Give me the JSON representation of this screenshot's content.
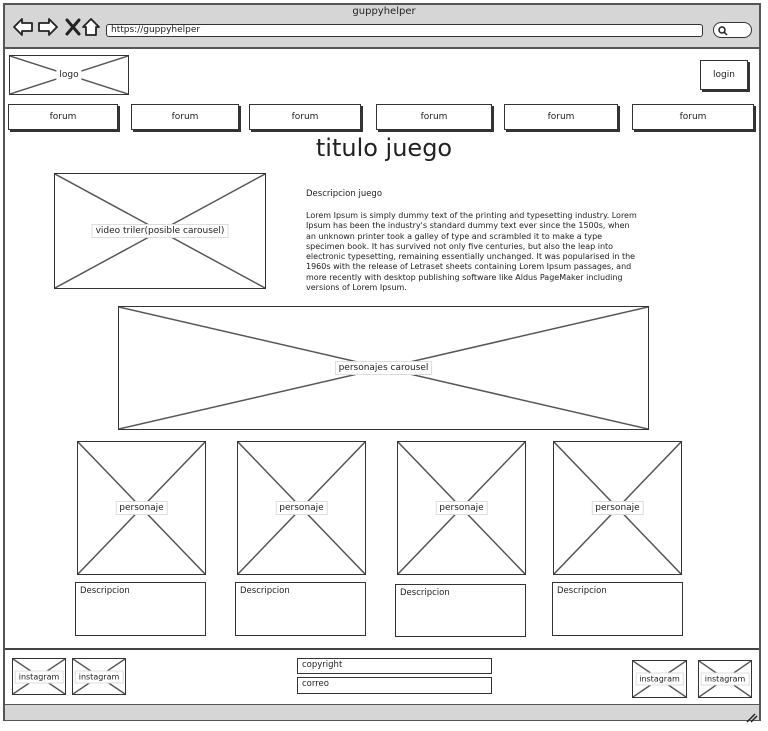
{
  "window": {
    "title": "guppyhelper"
  },
  "browser": {
    "url": "https://guppyhelper",
    "back_icon": "arrow-left-icon",
    "forward_icon": "arrow-right-icon",
    "stop_icon": "close-icon",
    "home_icon": "home-icon",
    "search_icon": "search-icon"
  },
  "header": {
    "logo": "logo",
    "login": "login"
  },
  "nav": [
    "forum",
    "forum",
    "forum",
    "forum",
    "forum",
    "forum"
  ],
  "game": {
    "title": "titulo juego",
    "video": "video triler(posible carousel)",
    "description_title": "Descripcion juego",
    "description_body": "Lorem Ipsum is simply dummy text of the printing and typesetting industry. Lorem Ipsum has been the industry's standard dummy text ever since the 1500s, when an unknown printer took a galley of type and scrambled it to make a type specimen book. It has survived not only five centuries, but also the leap into electronic typesetting, remaining essentially unchanged. It was popularised in the 1960s with the release of Letraset sheets containing Lorem Ipsum passages, and more recently with desktop publishing software like Aldus PageMaker including versions of Lorem Ipsum."
  },
  "characters": {
    "carousel": "personajes carousel",
    "items": [
      {
        "image": "personaje",
        "description": "Descripcion"
      },
      {
        "image": "personaje",
        "description": "Descripcion"
      },
      {
        "image": "personaje",
        "description": "Descripcion"
      },
      {
        "image": "personaje",
        "description": "Descripcion"
      }
    ]
  },
  "footer": {
    "left_links": [
      "instagram",
      "instagram"
    ],
    "right_links": [
      "instagram",
      "instagram"
    ],
    "copyright": "copyright",
    "email": "correo"
  }
}
